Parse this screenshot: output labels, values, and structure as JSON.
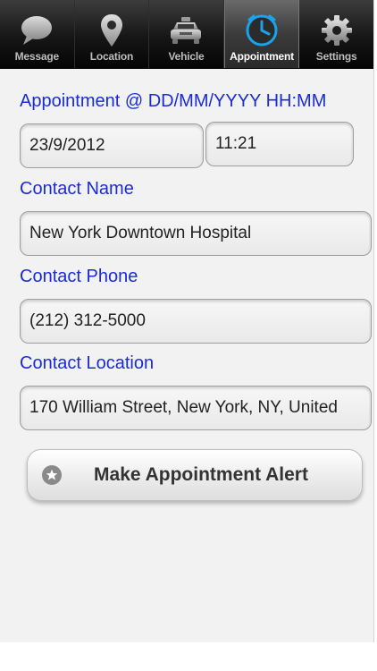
{
  "tabs": [
    {
      "label": "Message",
      "icon": "speech-bubble-icon",
      "active": false
    },
    {
      "label": "Location",
      "icon": "map-pin-icon",
      "active": false
    },
    {
      "label": "Vehicle",
      "icon": "taxi-car-icon",
      "active": false
    },
    {
      "label": "Appointment",
      "icon": "clock-icon",
      "active": true
    },
    {
      "label": "Settings",
      "icon": "gear-icon",
      "active": false
    }
  ],
  "appointment": {
    "label": "Appointment @ DD/MM/YYYY HH:MM",
    "date": "23/9/2012",
    "time": "11:21"
  },
  "contact_name": {
    "label": "Contact Name",
    "value": "New York Downtown Hospital"
  },
  "contact_phone": {
    "label": "Contact Phone",
    "value": "(212) 312-5000"
  },
  "contact_location": {
    "label": "Contact Location",
    "value": "170 William Street, New York, NY, United"
  },
  "alert_button": {
    "label": "Make Appointment Alert",
    "icon": "star-icon"
  },
  "colors": {
    "label_blue": "#1a2cd6",
    "tabbar_black": "#111111",
    "clock_accent": "#1aa3e8"
  }
}
